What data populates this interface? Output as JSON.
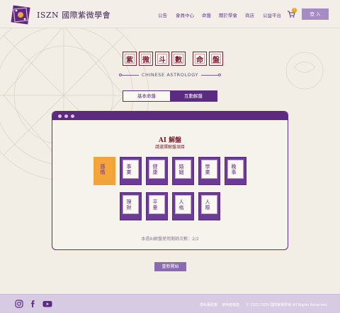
{
  "header": {
    "brand": "ISZN 國際紫微學會",
    "nav": [
      "公告",
      "會員中心",
      "命盤",
      "關於學會",
      "商店",
      "公益平台"
    ],
    "cart_count": "1",
    "login_label": "登 入"
  },
  "hero": {
    "title_chars": [
      "紫",
      "微",
      "斗",
      "數",
      "命",
      "盤"
    ],
    "subtitle": "CHINESE ASTROLOGY"
  },
  "tabs": [
    {
      "label": "基本命盤",
      "active": false
    },
    {
      "label": "互動解盤",
      "active": true
    }
  ],
  "panel": {
    "title": "AI 解盤",
    "subtitle": "請選擇解盤項目",
    "cards": [
      {
        "label": "感情",
        "selected": true
      },
      {
        "label": "事業",
        "selected": false
      },
      {
        "label": "健康",
        "selected": false
      },
      {
        "label": "婚姻",
        "selected": false
      },
      {
        "label": "學業",
        "selected": false
      },
      {
        "label": "晚事",
        "selected": false
      },
      {
        "label": "理財",
        "selected": false
      },
      {
        "label": "平輩",
        "selected": false
      },
      {
        "label": "人格",
        "selected": false
      },
      {
        "label": "人際",
        "selected": false
      }
    ],
    "usage_text": "本週AI解盤使用剩餘次數：2/2",
    "restart_label": "重新開始"
  },
  "footer": {
    "links": [
      "隱私權政策",
      "使用者條款"
    ],
    "copyright": "© 2022 ISZN 國際紫微學會 All Rights Reserved.",
    "social_icons": [
      "instagram-icon",
      "facebook-icon",
      "youtube-icon"
    ]
  },
  "colors": {
    "primary": "#5b2b82",
    "accent": "#f1a43a",
    "title_red": "#7a1f2e",
    "background": "#f2eee6",
    "footer": "#d6cbe2"
  }
}
